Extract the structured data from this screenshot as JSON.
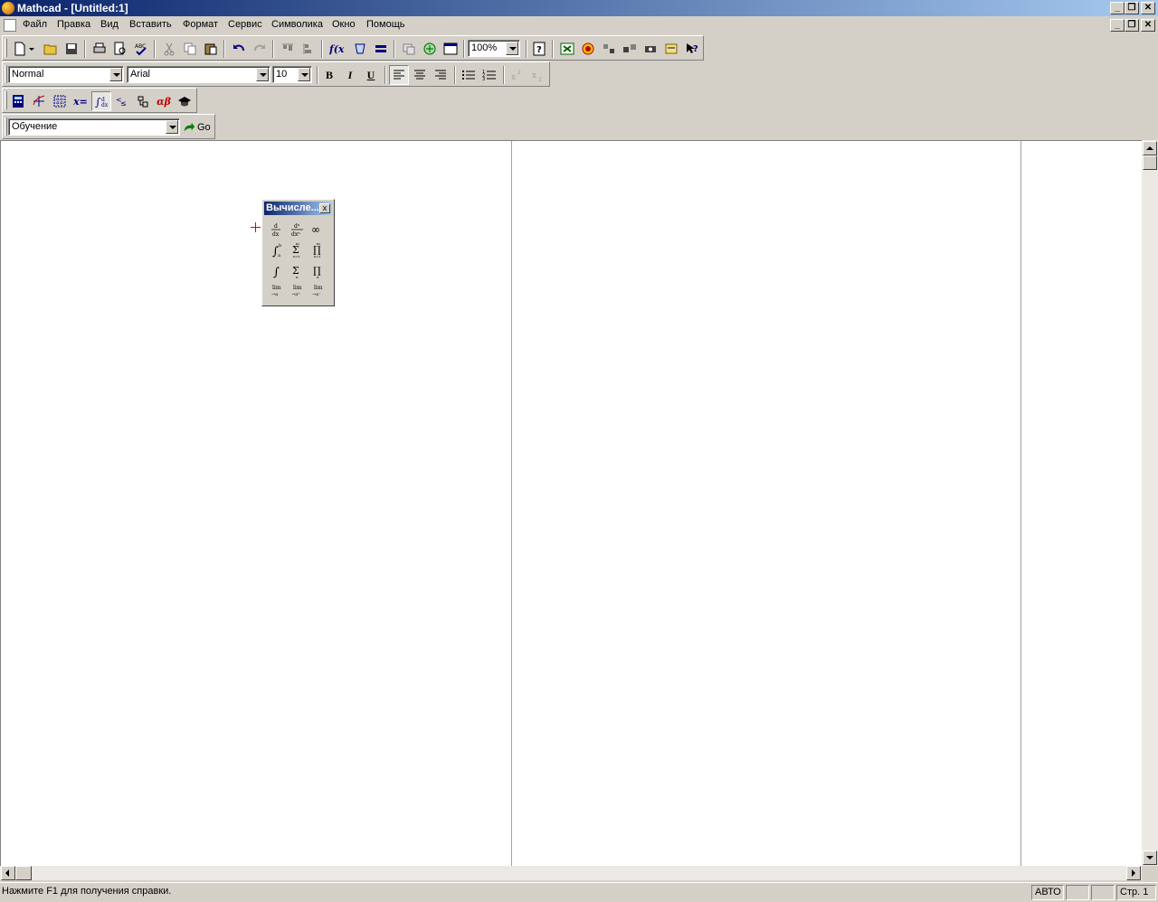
{
  "window": {
    "title": "Mathcad - [Untitled:1]"
  },
  "menu": {
    "items": [
      "Файл",
      "Правка",
      "Вид",
      "Вставить",
      "Формат",
      "Сервис",
      "Символика",
      "Окно",
      "Помощь"
    ]
  },
  "toolbar": {
    "zoom": "100%"
  },
  "format_bar": {
    "style": "Normal",
    "font": "Arial",
    "size": "10",
    "bold": "B",
    "italic": "I",
    "underline": "U"
  },
  "resources": {
    "selected": "Обучение",
    "go_label": "Go"
  },
  "palette": {
    "title": "Вычисле...",
    "close": "x"
  },
  "status": {
    "help_text": "Нажмите F1 для получения справки.",
    "mode": "АВТО",
    "page": "Стр. 1"
  },
  "colors": {
    "title_gradient_start": "#0a246a",
    "title_gradient_end": "#a6caf0",
    "cursor": "#dd0000"
  }
}
